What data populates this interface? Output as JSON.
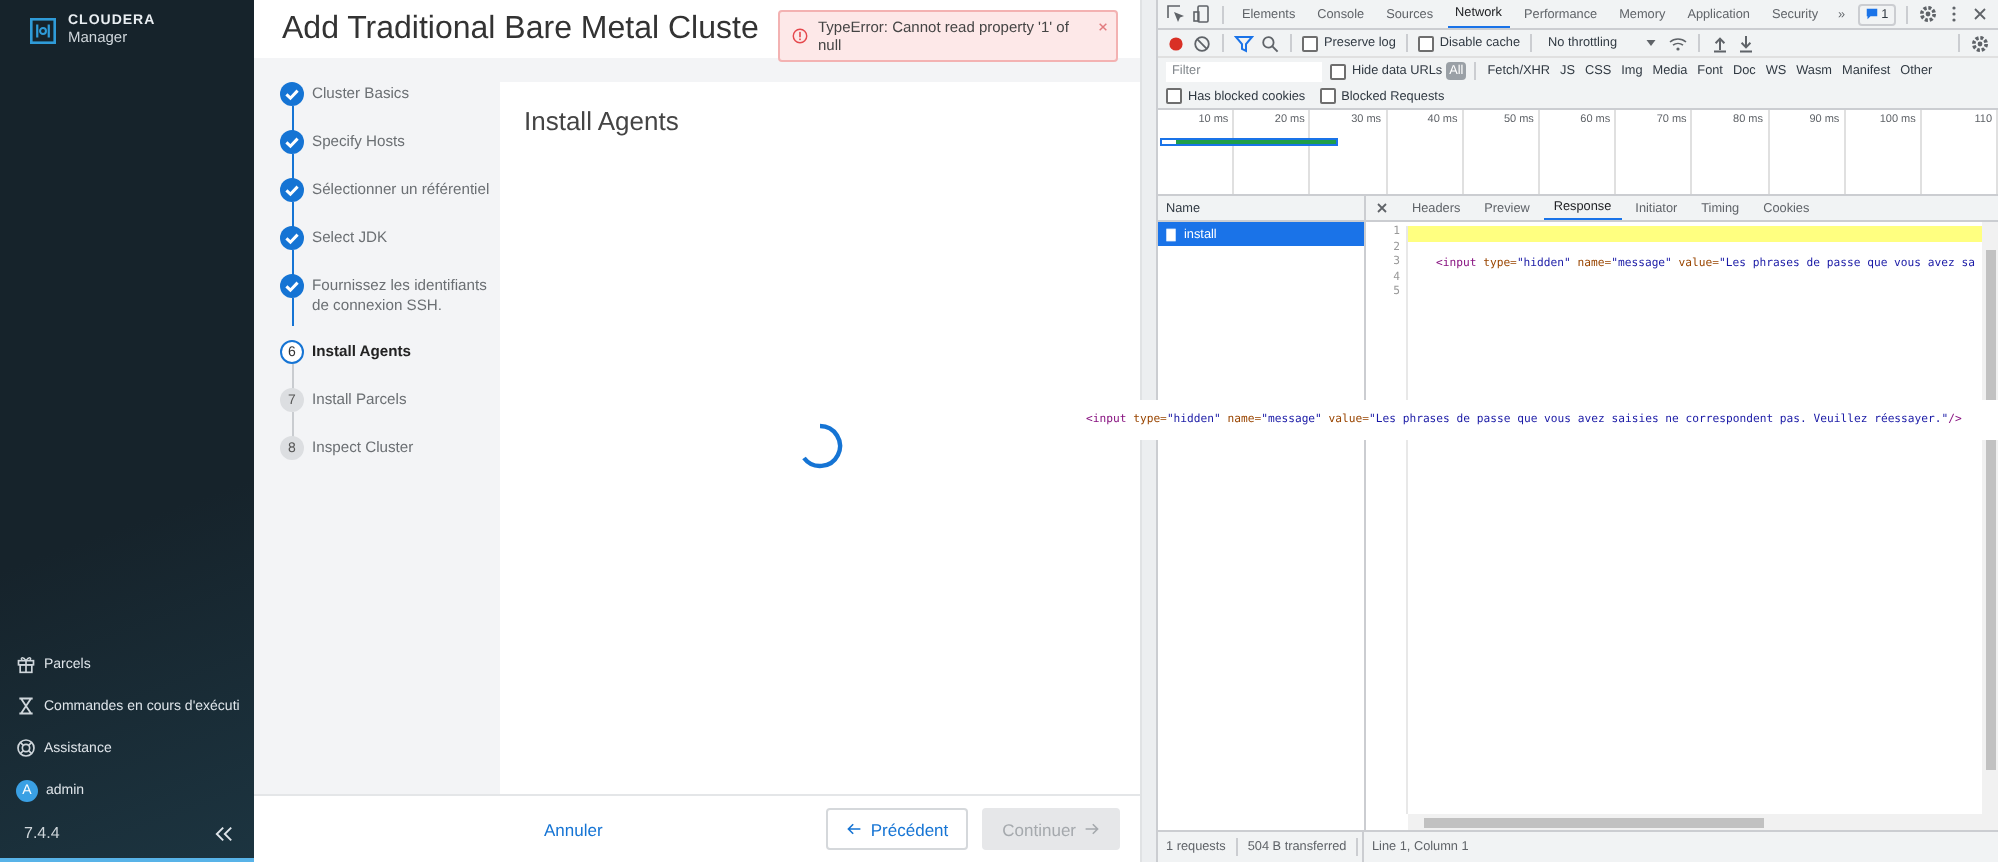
{
  "sidebar": {
    "logo": {
      "brand": "CLOUDERA",
      "product": "Manager"
    },
    "items": [
      {
        "kind": "parcels",
        "label": "Parcels"
      },
      {
        "kind": "commands",
        "label": "Commandes en cours d'exécuti"
      },
      {
        "kind": "support",
        "label": "Assistance"
      },
      {
        "kind": "user",
        "label": "admin",
        "avatar": "A"
      }
    ],
    "version": "7.4.4"
  },
  "wizard": {
    "title": "Add Traditional Bare Metal Cluste",
    "toast": {
      "message": "TypeError: Cannot read property '1' of null"
    },
    "steps": [
      {
        "label": "Cluster Basics",
        "completed": true,
        "selected": false
      },
      {
        "label": "Specify Hosts",
        "completed": true,
        "selected": false
      },
      {
        "label": "Sélectionner un référentiel",
        "completed": true,
        "selected": false
      },
      {
        "label": "Select JDK",
        "completed": true,
        "selected": false
      },
      {
        "label": "Fournissez les identifiants de connexion SSH.",
        "completed": true,
        "selected": false
      },
      {
        "number": "6",
        "label": "Install Agents",
        "completed": false,
        "selected": true
      },
      {
        "number": "7",
        "label": "Install Parcels",
        "completed": false,
        "selected": false
      },
      {
        "number": "8",
        "label": "Inspect Cluster",
        "completed": false,
        "selected": false
      }
    ],
    "panel": {
      "title": "Install Agents"
    },
    "footer": {
      "cancel": "Annuler",
      "back": "Précédent",
      "next": {
        "label": "Continuer",
        "disabled": true
      }
    }
  },
  "devtools": {
    "tabs": [
      {
        "label": "Elements",
        "selected": false
      },
      {
        "label": "Console",
        "selected": false
      },
      {
        "label": "Sources",
        "selected": false
      },
      {
        "label": "Network",
        "selected": true
      },
      {
        "label": "Performance",
        "selected": false
      },
      {
        "label": "Memory",
        "selected": false
      },
      {
        "label": "Application",
        "selected": false
      },
      {
        "label": "Security",
        "selected": false
      }
    ],
    "more": "»",
    "badge": "1",
    "toolbar": {
      "checkboxes": [
        {
          "label": "Preserve log",
          "checked": false
        },
        {
          "label": "Disable cache",
          "checked": false
        }
      ],
      "throttling": "No throttling"
    },
    "filter": {
      "placeholder": "Filter",
      "hide_data_urls": {
        "label": "Hide data URLs",
        "checked": false
      },
      "types": [
        {
          "label": "All",
          "selected": true
        },
        {
          "label": "Fetch/XHR",
          "selected": false
        },
        {
          "label": "JS",
          "selected": false
        },
        {
          "label": "CSS",
          "selected": false
        },
        {
          "label": "Img",
          "selected": false
        },
        {
          "label": "Media",
          "selected": false
        },
        {
          "label": "Font",
          "selected": false
        },
        {
          "label": "Doc",
          "selected": false
        },
        {
          "label": "WS",
          "selected": false
        },
        {
          "label": "Wasm",
          "selected": false
        },
        {
          "label": "Manifest",
          "selected": false
        },
        {
          "label": "Other",
          "selected": false
        }
      ]
    },
    "blocked": [
      {
        "label": "Has blocked cookies",
        "checked": false
      },
      {
        "label": "Blocked Requests",
        "checked": false
      }
    ],
    "timeline_ticks": [
      "10 ms",
      "20 ms",
      "30 ms",
      "40 ms",
      "50 ms",
      "60 ms",
      "70 ms",
      "80 ms",
      "90 ms",
      "100 ms",
      "110"
    ],
    "requests": {
      "header": "Name",
      "rows": [
        {
          "name": "install",
          "selected": true
        }
      ]
    },
    "detail_tabs": [
      {
        "label": "Headers",
        "selected": false
      },
      {
        "label": "Preview",
        "selected": false
      },
      {
        "label": "Response",
        "selected": true
      },
      {
        "label": "Initiator",
        "selected": false
      },
      {
        "label": "Timing",
        "selected": false
      },
      {
        "label": "Cookies",
        "selected": false
      }
    ],
    "code_lines": [
      {
        "number": "1",
        "highlighted": true
      },
      {
        "number": "2",
        "highlighted": false
      },
      {
        "number": "3",
        "highlighted": false,
        "tokens": [
          {
            "kind": "tag",
            "text": "<input"
          },
          {
            "kind": "attr",
            "text": " type="
          },
          {
            "kind": "value",
            "text": "\"hidden\""
          },
          {
            "kind": "attr",
            "text": " name="
          },
          {
            "kind": "value",
            "text": "\"message\""
          },
          {
            "kind": "attr",
            "text": " value="
          },
          {
            "kind": "value",
            "text": "\"Les phrases de passe que vous avez sa"
          }
        ]
      },
      {
        "number": "4",
        "highlighted": false
      },
      {
        "number": "5",
        "highlighted": false
      }
    ],
    "status": [
      "1 requests",
      "504 B transferred"
    ],
    "cursor": "Line 1, Column 1",
    "tooltip": [
      {
        "kind": "tag",
        "text": "<input"
      },
      {
        "kind": "attr",
        "text": " type="
      },
      {
        "kind": "value",
        "text": "\"hidden\""
      },
      {
        "kind": "attr",
        "text": " name="
      },
      {
        "kind": "value",
        "text": "\"message\""
      },
      {
        "kind": "attr",
        "text": " value="
      },
      {
        "kind": "value",
        "text": "\"Les phrases de passe que vous avez saisies ne correspondent pas. Veuillez réessayer.\""
      },
      {
        "kind": "tag",
        "text": "/>"
      }
    ]
  }
}
